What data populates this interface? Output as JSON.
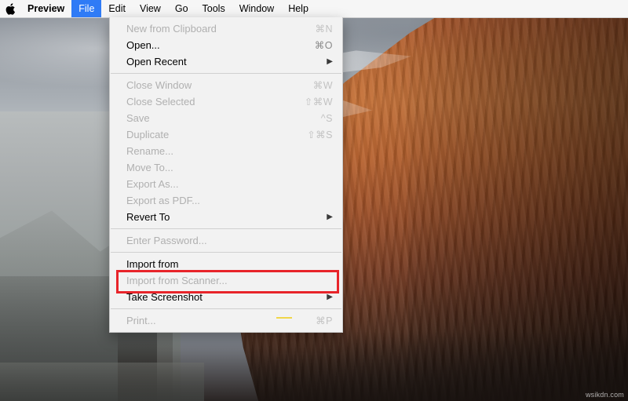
{
  "menubar": {
    "apple_icon": "apple-logo-icon",
    "items": [
      {
        "label": "Preview",
        "bold": true,
        "active": false
      },
      {
        "label": "File",
        "bold": false,
        "active": true
      },
      {
        "label": "Edit",
        "bold": false,
        "active": false
      },
      {
        "label": "View",
        "bold": false,
        "active": false
      },
      {
        "label": "Go",
        "bold": false,
        "active": false
      },
      {
        "label": "Tools",
        "bold": false,
        "active": false
      },
      {
        "label": "Window",
        "bold": false,
        "active": false
      },
      {
        "label": "Help",
        "bold": false,
        "active": false
      }
    ]
  },
  "file_menu": {
    "items": [
      {
        "label": "New from Clipboard",
        "shortcut": "⌘N",
        "state": "disabled",
        "submenu": false
      },
      {
        "label": "Open...",
        "shortcut": "⌘O",
        "state": "enabled",
        "submenu": false
      },
      {
        "label": "Open Recent",
        "shortcut": "",
        "state": "enabled",
        "submenu": true
      },
      {
        "separator": true
      },
      {
        "label": "Close Window",
        "shortcut": "⌘W",
        "state": "disabled",
        "submenu": false
      },
      {
        "label": "Close Selected",
        "shortcut": "⇧⌘W",
        "state": "disabled",
        "submenu": false
      },
      {
        "label": "Save",
        "shortcut": "^S",
        "state": "disabled",
        "submenu": false
      },
      {
        "label": "Duplicate",
        "shortcut": "⇧⌘S",
        "state": "disabled",
        "submenu": false
      },
      {
        "label": "Rename...",
        "shortcut": "",
        "state": "disabled",
        "submenu": false
      },
      {
        "label": "Move To...",
        "shortcut": "",
        "state": "disabled",
        "submenu": false
      },
      {
        "label": "Export As...",
        "shortcut": "",
        "state": "disabled",
        "submenu": false
      },
      {
        "label": "Export as PDF...",
        "shortcut": "",
        "state": "disabled",
        "submenu": false
      },
      {
        "label": "Revert To",
        "shortcut": "",
        "state": "enabled",
        "submenu": true
      },
      {
        "separator": true
      },
      {
        "label": "Enter Password...",
        "shortcut": "",
        "state": "disabled",
        "submenu": false
      },
      {
        "separator": true
      },
      {
        "label": "Import from",
        "shortcut": "",
        "state": "enabled",
        "submenu": false
      },
      {
        "label": "Import from Scanner...",
        "shortcut": "",
        "state": "disabled",
        "submenu": false
      },
      {
        "label": "Take Screenshot",
        "shortcut": "",
        "state": "enabled",
        "submenu": true
      },
      {
        "separator": true
      },
      {
        "label": "Print...",
        "shortcut": "⌘P",
        "state": "disabled",
        "submenu": false
      }
    ]
  },
  "annotation": {
    "highlight_color": "#e8242a",
    "highlight_target": "Import from"
  },
  "desktop": {
    "wallpaper_name": "el-capitan-wallpaper",
    "watermark": "wsikdn.com"
  },
  "colors": {
    "menubar_bg": "#f6f6f6",
    "menu_bg": "#f2f2f2",
    "active_menu_bg": "#2f7bf6",
    "disabled_text": "#b0b0b0",
    "shortcut_text": "#8a8a8a",
    "highlight": "#e8242a"
  }
}
